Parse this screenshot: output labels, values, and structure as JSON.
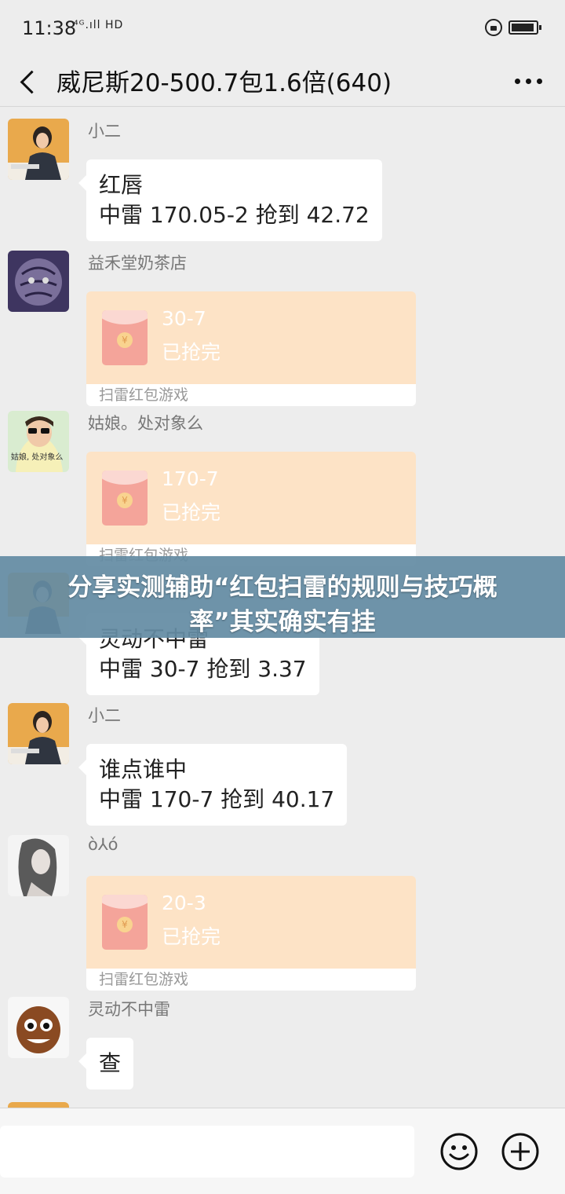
{
  "status_bar": {
    "time": "11:38",
    "signal": "⁴ᴳ.ıll HD"
  },
  "nav": {
    "title": "威尼斯20-500.7包1.6倍(640)"
  },
  "messages": [
    {
      "sender": "小二",
      "lines": [
        "红唇",
        "中雷 170.05-2 抢到 42.72"
      ]
    },
    {
      "sender": "益禾堂奶茶店",
      "amount": "30-7",
      "status": "已抢完",
      "footer": "扫雷红包游戏"
    },
    {
      "sender": "姑娘。处对象么",
      "amount": "170-7",
      "status": "已抢完",
      "footer": "扫雷红包游戏",
      "avatar_caption": "姑娘, 处对象么"
    },
    {
      "sender": "",
      "lines": [
        "灵动不中雷",
        "中雷 30-7 抢到 3.37"
      ]
    },
    {
      "sender": "小二",
      "lines": [
        "谁点谁中",
        "中雷 170-7 抢到 40.17"
      ]
    },
    {
      "sender": "ò⅄ó",
      "amount": "20-3",
      "status": "已抢完",
      "footer": "扫雷红包游戏"
    },
    {
      "sender": "灵动不中雷",
      "lines": [
        "查"
      ]
    }
  ],
  "overlay": {
    "line1": "分享实测辅助“红包扫雷的规则与技巧概",
    "line2": "率”其实确实有挂"
  },
  "input": {
    "placeholder": ""
  },
  "icons": {
    "back": "back-arrow-icon",
    "more": "more-icon",
    "emoji": "emoji-icon",
    "plus": "plus-icon",
    "lock": "lock-rotation-icon",
    "battery": "battery-icon",
    "coin": "yuan-coin-icon"
  },
  "colors": {
    "background": "#ededed",
    "red_packet": "#fde3c6",
    "overlay": "#648ca4"
  }
}
